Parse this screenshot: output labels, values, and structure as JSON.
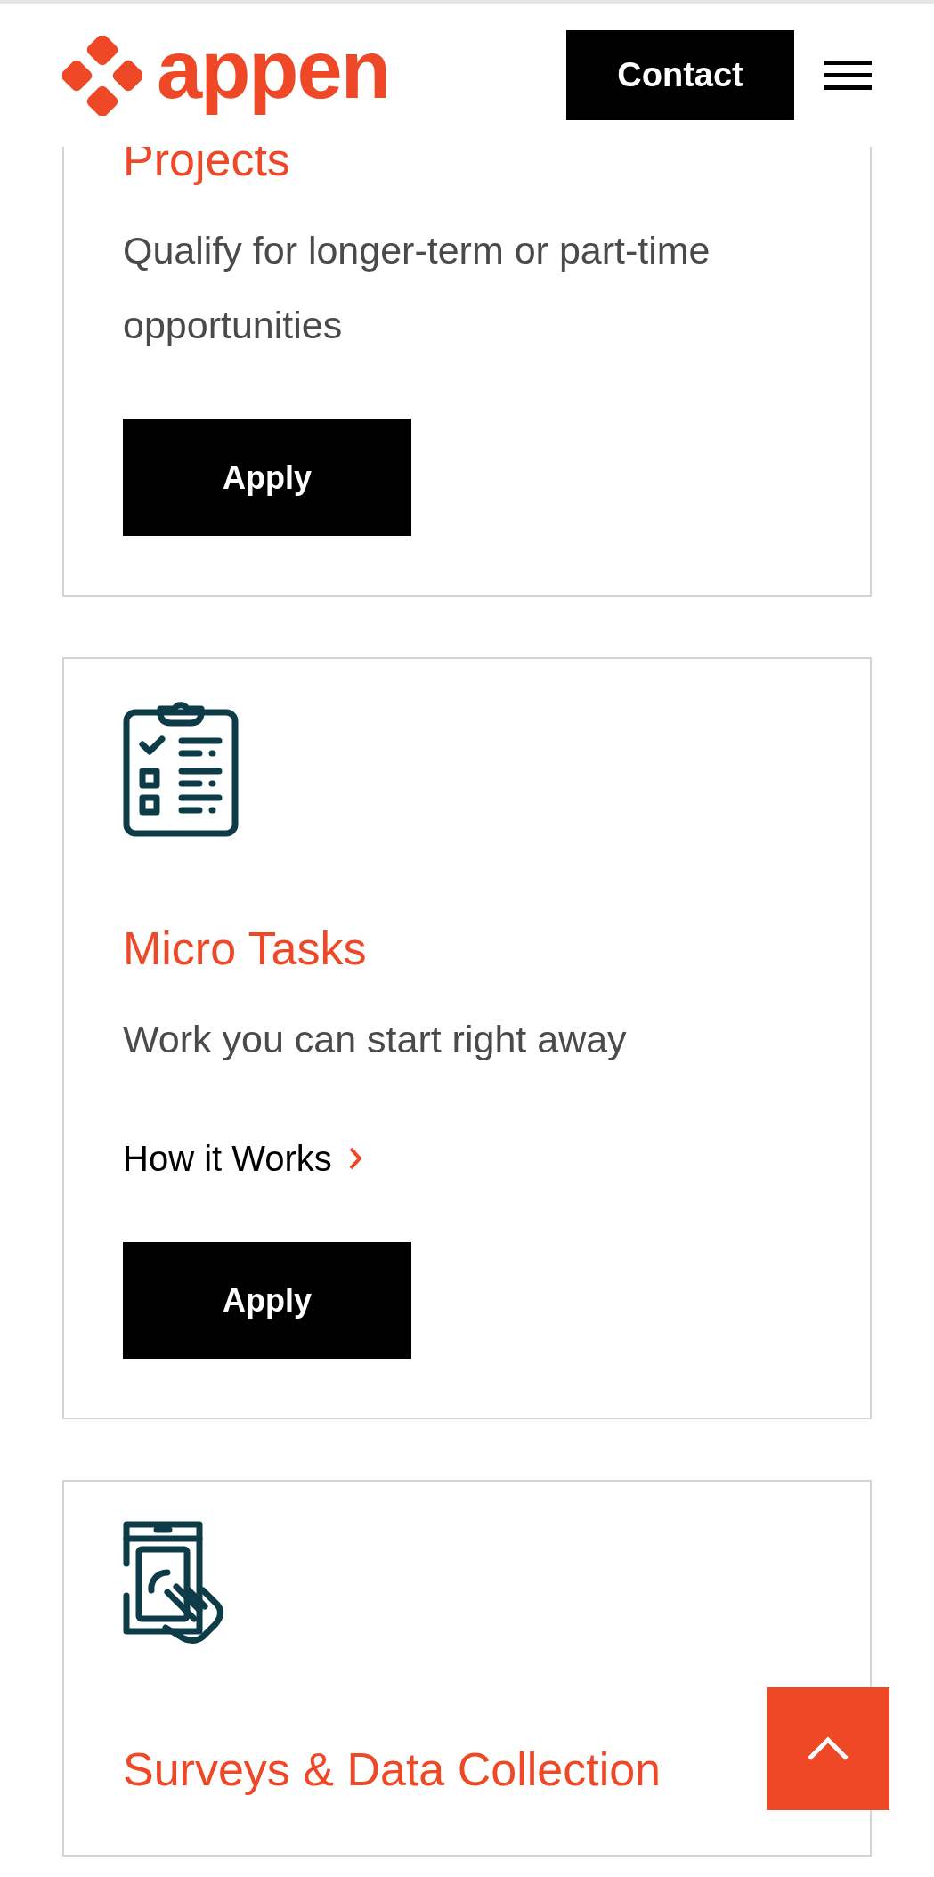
{
  "header": {
    "logo_text": "appen",
    "contact_button": "Contact"
  },
  "cards": [
    {
      "title": "Projects",
      "description": "Qualify for longer-term or part-time opportunities",
      "apply_button": "Apply"
    },
    {
      "title": "Micro Tasks",
      "description": "Work you can start right away",
      "link": "How it Works",
      "apply_button": "Apply"
    },
    {
      "title": "Surveys & Data Collection"
    }
  ]
}
